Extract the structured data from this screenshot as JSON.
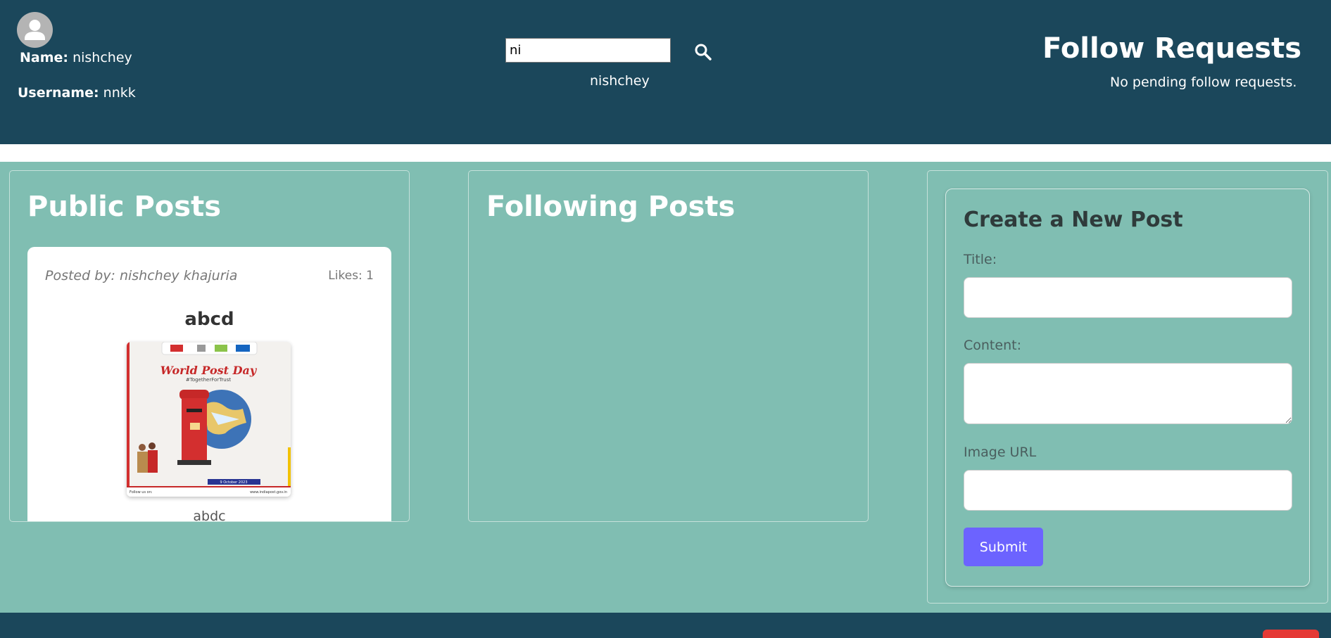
{
  "profile": {
    "name_label": "Name:",
    "name_value": "nishchey",
    "username_label": "Username:",
    "username_value": "nnkk"
  },
  "search": {
    "value": "ni",
    "result": "nishchey"
  },
  "follow_requests": {
    "title": "Follow Requests",
    "empty_text": "No pending follow requests."
  },
  "public_posts": {
    "title": "Public Posts",
    "posts": [
      {
        "author": "Posted by: nishchey khajuria",
        "likes": "Likes: 1",
        "title": "abcd",
        "image": {
          "title": "World Post Day",
          "hashtag": "#TogetherForTrust",
          "date": "9 October 2023",
          "follow_text": "Follow us on:",
          "site": "www.indiapost.gov.in"
        },
        "content": "abdc"
      }
    ]
  },
  "following_posts": {
    "title": "Following Posts"
  },
  "create_post": {
    "title": "Create a New Post",
    "title_label": "Title:",
    "content_label": "Content:",
    "image_label": "Image URL",
    "submit_label": "Submit"
  },
  "colors": {
    "header_bg": "#1b475b",
    "main_bg": "#80beb2",
    "submit": "#6c63ff",
    "footer_button": "#e53935"
  },
  "icons": {
    "avatar": "user-avatar-icon",
    "search": "search-icon"
  }
}
